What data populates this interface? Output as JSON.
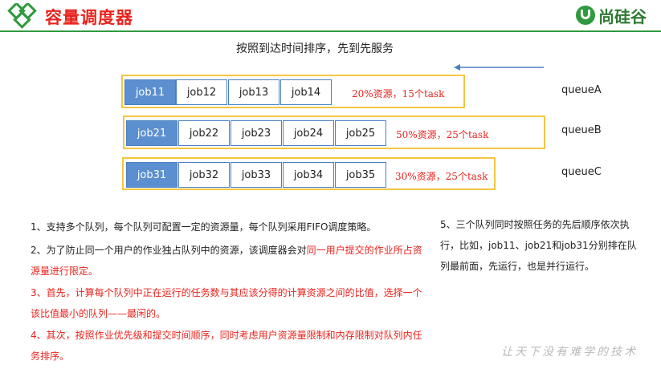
{
  "header": {
    "title": "容量调度器",
    "brand": "尚硅谷"
  },
  "subtitle": "按照到达时间排序，先到先服务",
  "queues": [
    {
      "name": "queueA",
      "jobs": [
        "job11",
        "job12",
        "job13",
        "job14"
      ],
      "info": "20%资源，15个task"
    },
    {
      "name": "queueB",
      "jobs": [
        "job21",
        "job22",
        "job23",
        "job24",
        "job25"
      ],
      "info": "50%资源，25个task"
    },
    {
      "name": "queueC",
      "jobs": [
        "job31",
        "job32",
        "job33",
        "job34",
        "job35"
      ],
      "info": "30%资源，25个task"
    }
  ],
  "notes": {
    "n1": "1、支持多个队列，每个队列可配置一定的资源量，每个队列采用FIFO调度策略。",
    "n2_a": "2、为了防止同一个用户的作业独占队列中的资源，该调度器会对",
    "n2_b": "同一用户提交的作业所占资源量进行限定。",
    "n3": "3、首先，计算每个队列中正在运行的任务数与其应该分得的计算资源之间的比值，选择一个该比值最小的队列——最闲的。",
    "n4": "4、其次，按照作业优先级和提交时间顺序，同时考虑用户资源量限制和内存限制对队列内任务排序。",
    "n5": "5、三个队列同时按照任务的先后顺序依次执行，比如，job11、job21和job31分别排在队列最前面，先运行，也是并行运行。"
  },
  "watermark": "让天下没有难学的技术",
  "colors": {
    "accent": "#e8231e",
    "brand_green": "#2f9a3e",
    "job_blue": "#5b8fd0",
    "queue_border": "#f5c542"
  },
  "icons": {
    "logo": "diamond-logo-icon",
    "brand": "brand-logo-icon",
    "arrow": "left-arrow-icon"
  }
}
